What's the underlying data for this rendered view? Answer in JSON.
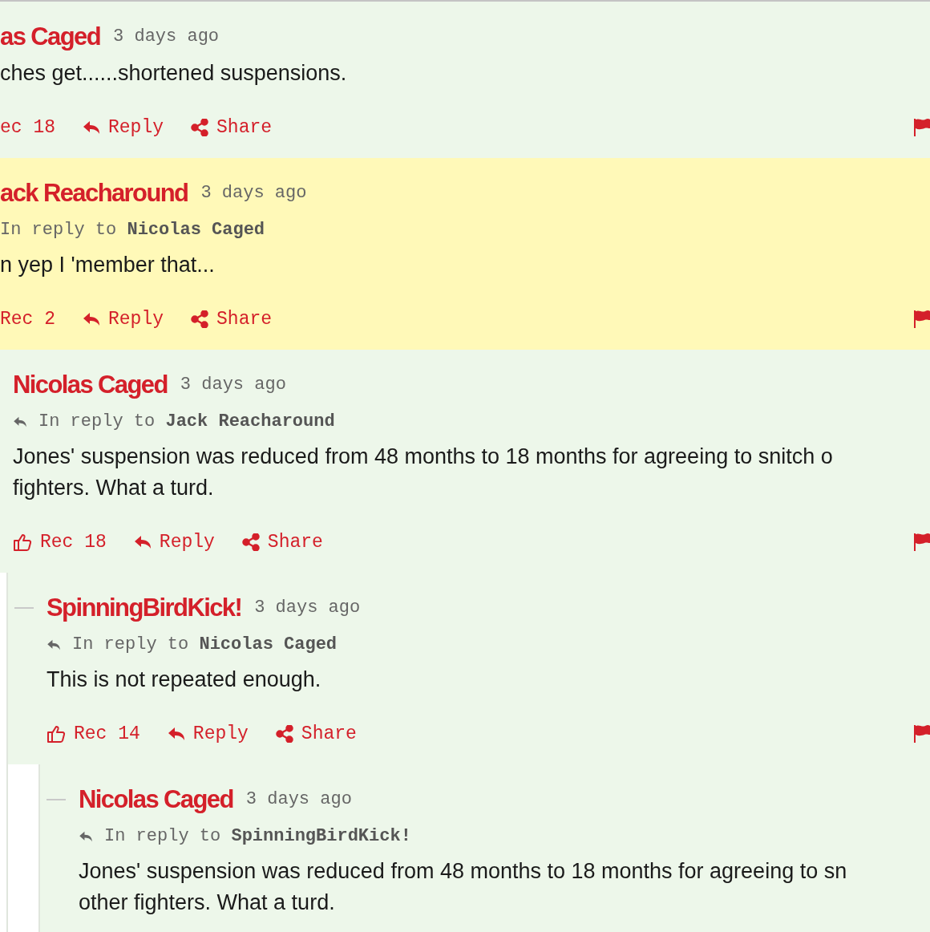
{
  "comments": [
    {
      "author": "as Caged",
      "time": "3 days ago",
      "left_icons": false,
      "highlighted": false,
      "body": [
        "ches get......shortened suspensions."
      ],
      "rec": "ec 18",
      "reply": "Reply",
      "share": "Share"
    },
    {
      "author": "ack Reacharound",
      "time": "3 days ago",
      "left_icons": false,
      "highlighted": true,
      "reply_prefix": "In reply to",
      "reply_to": "Nicolas Caged",
      "body": [
        "n yep I 'member that..."
      ],
      "rec": "Rec 2",
      "reply": "Reply",
      "share": "Share"
    },
    {
      "author": "Nicolas Caged",
      "time": "3 days ago",
      "left_icons": true,
      "highlighted": false,
      "reply_prefix": "In reply to",
      "reply_to": "Jack Reacharound",
      "body": [
        "Jones' suspension was reduced from 48 months to 18 months for agreeing to snitch o",
        "fighters. What a turd."
      ],
      "rec": "Rec 18",
      "reply": "Reply",
      "share": "Share",
      "children": [
        {
          "author": "SpinningBirdKick!",
          "time": "3 days ago",
          "left_icons": true,
          "highlighted": false,
          "reply_prefix": "In reply to",
          "reply_to": "Nicolas Caged",
          "body": [
            "This is not repeated enough."
          ],
          "rec": "Rec 14",
          "reply": "Reply",
          "share": "Share",
          "children": [
            {
              "author": "Nicolas Caged",
              "time": "3 days ago",
              "left_icons": true,
              "highlighted": false,
              "reply_prefix": "In reply to",
              "reply_to": "SpinningBirdKick!",
              "body": [
                "Jones' suspension was reduced from 48 months to 18 months for agreeing to sn",
                "other fighters. What a turd."
              ]
            }
          ]
        }
      ]
    }
  ]
}
